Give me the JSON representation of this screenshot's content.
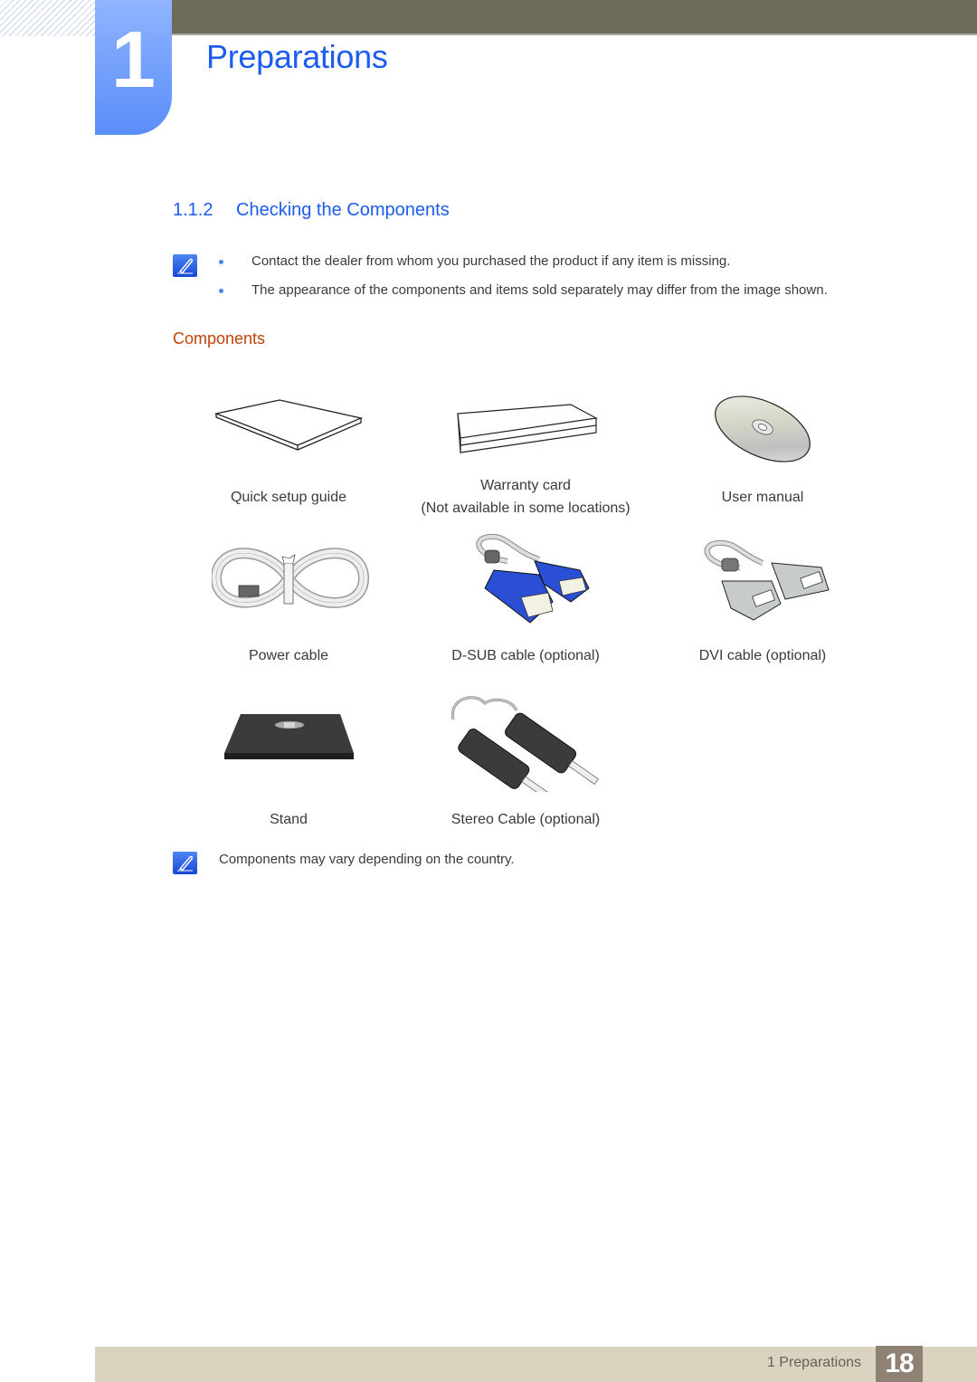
{
  "header": {
    "chapter_number": "1",
    "chapter_title": "Preparations",
    "colors": {
      "accent_blue": "#1c5cf2",
      "top_bar": "#6d6b5a",
      "sub_heading": "#c14208"
    }
  },
  "section": {
    "number": "1.1.2",
    "title": "Checking the Components",
    "notes": [
      "Contact the dealer from whom you purchased the product if any item is missing.",
      "The appearance of the components and items sold separately may differ from the image shown."
    ]
  },
  "components": {
    "heading": "Components",
    "items": [
      {
        "icon": "booklet-icon",
        "label": "Quick setup guide",
        "sublabel": ""
      },
      {
        "icon": "warranty-card-icon",
        "label": "Warranty card",
        "sublabel": "(Not available in some locations)"
      },
      {
        "icon": "cd-icon",
        "label": "User manual",
        "sublabel": ""
      },
      {
        "icon": "power-cable-icon",
        "label": "Power cable",
        "sublabel": ""
      },
      {
        "icon": "dsub-cable-icon",
        "label": "D-SUB cable (optional)",
        "sublabel": ""
      },
      {
        "icon": "dvi-cable-icon",
        "label": "DVI cable (optional)",
        "sublabel": ""
      },
      {
        "icon": "stand-icon",
        "label": "Stand",
        "sublabel": ""
      },
      {
        "icon": "stereo-cable-icon",
        "label": "Stereo Cable (optional)",
        "sublabel": ""
      }
    ],
    "footnote": "Components may vary depending on the country."
  },
  "footer": {
    "section_label": "1 Preparations",
    "page_number": "18"
  }
}
